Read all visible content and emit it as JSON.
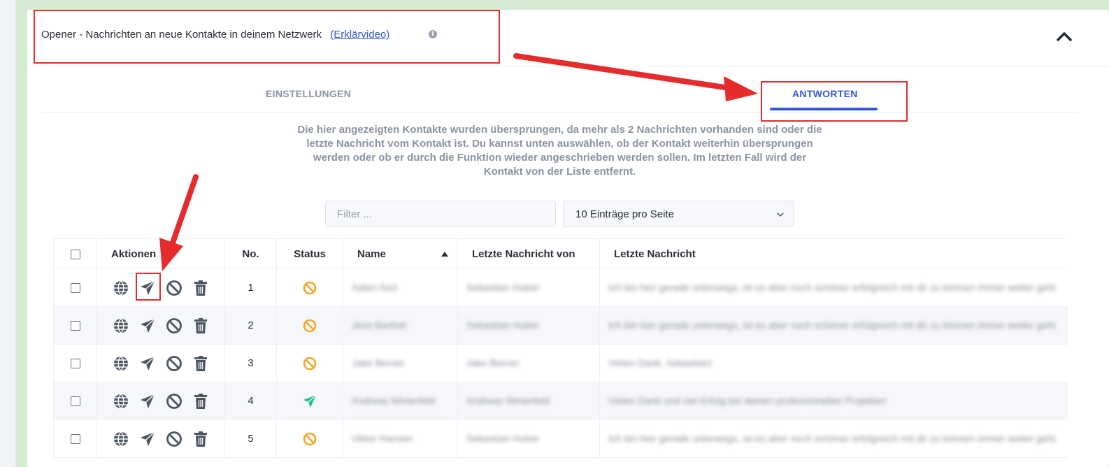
{
  "header": {
    "title": "Opener - Nachrichten an neue Kontakte in deinem Netzwerk",
    "link_label": "(Erklärvideo)",
    "info_symbol": "i"
  },
  "tabs": [
    {
      "label": "EINSTELLUNGEN",
      "active": false
    },
    {
      "label": "ANTWORTEN",
      "active": true
    }
  ],
  "description": "Die hier angezeigten Kontakte wurden übersprungen, da mehr als 2 Nachrichten vorhanden sind oder die letzte Nachricht vom Kontakt ist. Du kannst unten auswählen, ob der Kontakt weiterhin übersprungen werden oder ob er durch die Funktion wieder angeschrieben werden sollen. Im letzten Fall wird der Kontakt von der Liste entfernt.",
  "filter": {
    "placeholder": "Filter ...",
    "value": ""
  },
  "page_size": {
    "selected": "10 Einträge pro Seite"
  },
  "table": {
    "headers": {
      "actions": "Aktionen",
      "no": "No.",
      "status": "Status",
      "name": "Name",
      "last_from": "Letzte Nachricht von",
      "last_message": "Letzte Nachricht"
    },
    "sort": {
      "column": "name",
      "direction": "ascending"
    },
    "rows": [
      {
        "no": "1",
        "status": "skipped",
        "name": "Adam Kerl",
        "from": "Sebastian Huber",
        "message": "Ich bin hier gerade unterwegs, ist es aber noch schöner erfolgreich mit dir zu können immer weiter geht"
      },
      {
        "no": "2",
        "status": "skipped",
        "name": "Jens Barthel",
        "from": "Sebastian Huber",
        "message": "Ich bin hier gerade unterwegs, ist es aber noch schöner erfolgreich mit dir zu können immer weiter geht"
      },
      {
        "no": "3",
        "status": "skipped",
        "name": "Jake Berner",
        "from": "Jake Berner",
        "message": "Vielen Dank, Sebastian!"
      },
      {
        "no": "4",
        "status": "sent",
        "name": "Andreas Winterfeld",
        "from": "Andreas Winterfeld",
        "message": "Vielen Dank und viel Erfolg bei deinen professionellen Projekten"
      },
      {
        "no": "5",
        "status": "skipped",
        "name": "Viktor Hansen",
        "from": "Sebastian Huber",
        "message": "Ich bin hier gerade unterwegs, ist es aber noch schöner erfolgreich mit dir zu können immer weiter geht"
      }
    ]
  },
  "colors": {
    "accent": "#3358d4",
    "annotation": "#e52b2b",
    "status_skipped": "#f4a72a",
    "status_sent": "#1fc28a",
    "icon_gray": "#4b5563"
  }
}
